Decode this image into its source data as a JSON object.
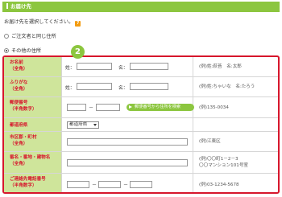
{
  "header": {
    "title": "お届け先"
  },
  "instruction": "お届け先を選択してください。",
  "options": [
    {
      "label": "ご注文者と同じ住所",
      "selected": false
    },
    {
      "label": "その他の住所",
      "selected": true
    }
  ],
  "step_number": "2",
  "form": {
    "rows": [
      {
        "label": "お名前",
        "sub": "（全角）",
        "parts": [
          "姓：",
          "名："
        ],
        "example": "(例)姓:萩苔　名:太郎"
      },
      {
        "label": "ふりがな",
        "sub": "（全角）",
        "parts": [
          "姓：",
          "名："
        ],
        "example": "(例)姓:ちゃいな　名:たろう"
      },
      {
        "label": "郵便番号",
        "sub": "（半角数字）",
        "dash": "－",
        "button": "郵便番号から住所を検索",
        "example": "(例)135-0034"
      },
      {
        "label": "都道府県",
        "select": "都道府県",
        "example": ""
      },
      {
        "label": "市区郡・町村",
        "sub": "（全角）",
        "example": "(例)江東区"
      },
      {
        "label": "番名・番地・建物名",
        "sub": "（全角）",
        "example": "(例)〇〇町1－2－3",
        "example2": "〇〇マンション101号室"
      },
      {
        "label": "ご連絡先電話番号",
        "sub": "（半角数字）",
        "dash": "－",
        "example": "(例)03-1234-5678"
      }
    ]
  }
}
